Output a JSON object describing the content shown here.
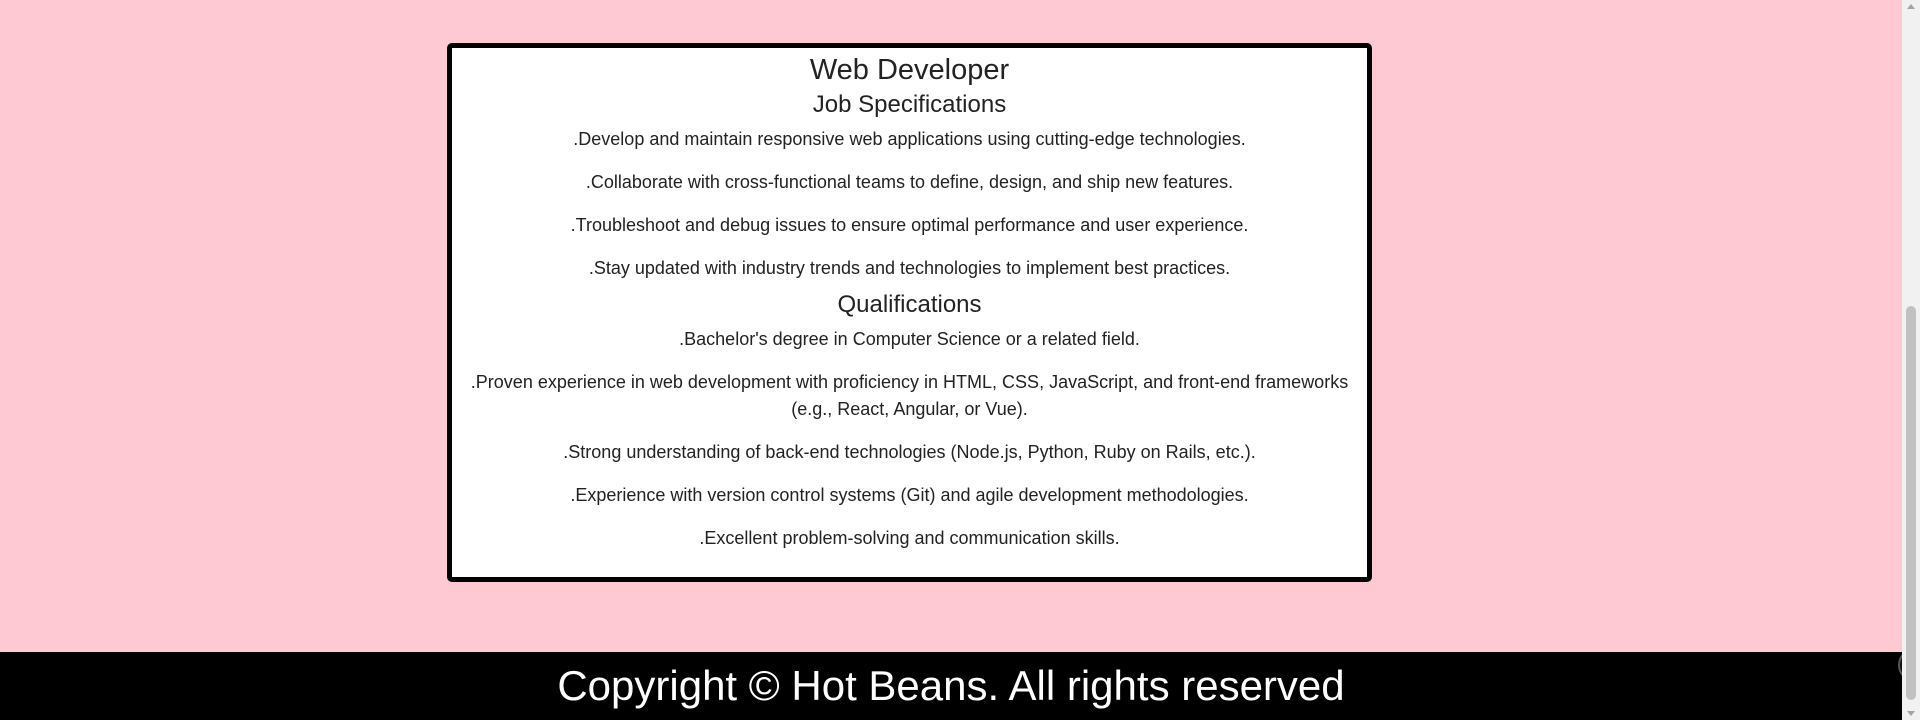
{
  "job": {
    "title": "Web Developer",
    "specifications_heading": "Job Specifications",
    "specifications": [
      ".Develop and maintain responsive web applications using cutting-edge technologies.",
      ".Collaborate with cross-functional teams to define, design, and ship new features.",
      ".Troubleshoot and debug issues to ensure optimal performance and user experience.",
      ".Stay updated with industry trends and technologies to implement best practices."
    ],
    "qualifications_heading": "Qualifications",
    "qualifications": [
      ".Bachelor's degree in Computer Science or a related field.",
      ".Proven experience in web development with proficiency in HTML, CSS, JavaScript, and front-end frameworks (e.g., React, Angular, or Vue).",
      ".Strong understanding of back-end technologies (Node.js, Python, Ruby on Rails, etc.).",
      ".Experience with version control systems (Git) and agile development methodologies.",
      ".Excellent problem-solving and communication skills."
    ]
  },
  "footer": {
    "copyright": "Copyright © Hot Beans. All rights reserved"
  },
  "floating_button": {
    "icon": "chevron-left-icon",
    "glyph": "‹"
  },
  "colors": {
    "page_background": "#ffc9d3",
    "card_background": "#ffffff",
    "card_border": "#000000",
    "footer_background": "#000000",
    "footer_text": "#ffffff"
  }
}
